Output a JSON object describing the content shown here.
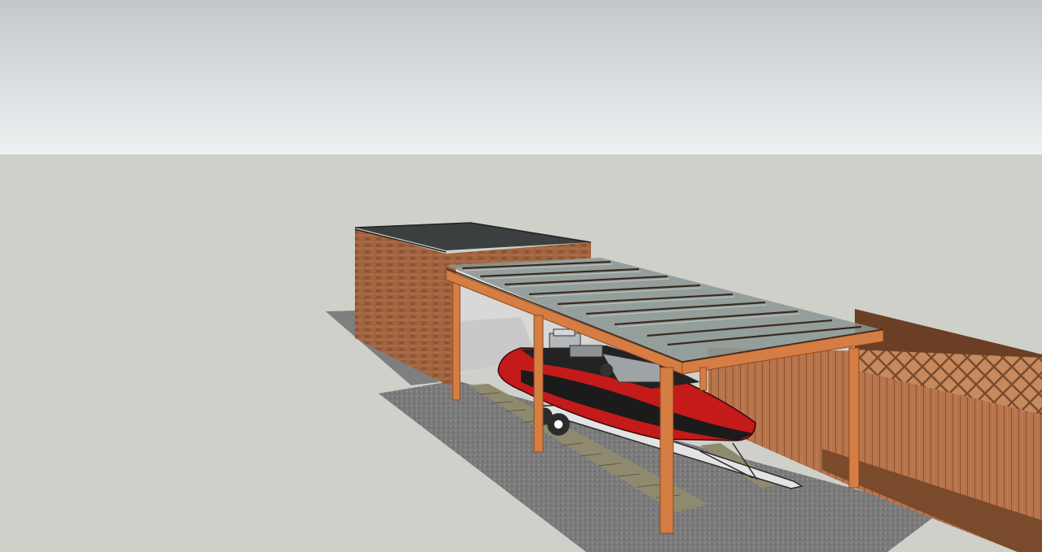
{
  "scene": {
    "sky_color_top": "#c3c7c9",
    "sky_color_bottom": "#eef1f2",
    "ground_color": "#d0d0cb",
    "objects": [
      "brick-garage",
      "carport-roof",
      "speedboat",
      "boat-trailer",
      "wooden-fence",
      "gravel-driveway",
      "paving-strip"
    ]
  },
  "colors": {
    "brick": "#9b5e3c",
    "timber": "#d57d43",
    "timber_dark": "#a85a2c",
    "fence": "#b8764a",
    "boat_red": "#c41a1a",
    "boat_black": "#1b1b1b",
    "gravel": "#807f7f",
    "roof_dark": "#3b3f40"
  }
}
